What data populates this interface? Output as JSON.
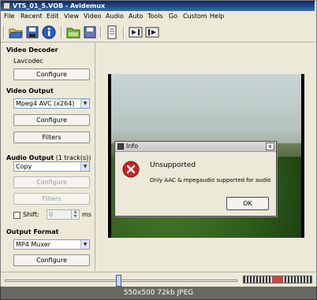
{
  "window": {
    "title": "VTS_01_5.VOB - Avidemux"
  },
  "menu": [
    "File",
    "Recent",
    "Edit",
    "View",
    "Video",
    "Audio",
    "Auto",
    "Tools",
    "Go",
    "Custom",
    "Help"
  ],
  "toolbar": {
    "icons": [
      "open-folder-icon",
      "save-icon",
      "info-icon",
      "open-green-icon",
      "save-small-icon",
      "document-icon",
      "play-to-icon",
      "play-from-icon"
    ]
  },
  "panel": {
    "video_decoder": {
      "heading": "Video Decoder",
      "codec": "Lavcodec",
      "configure": "Configure"
    },
    "video_output": {
      "heading": "Video Output",
      "selected": "Mpeg4 AVC (x264)",
      "configure": "Configure",
      "filters": "Filters"
    },
    "audio_output": {
      "heading": "Audio Output",
      "tracks": "(1 track(s))",
      "selected": "Copy",
      "configure": "Configure",
      "filters": "Filters",
      "shift_label": "Shift:",
      "shift_value": "0",
      "shift_unit": "ms"
    },
    "output_format": {
      "heading": "Output Format",
      "selected": "MP4 Muxer",
      "configure": "Configure"
    }
  },
  "dialog": {
    "title": "Info",
    "close": "x",
    "heading": "Unsupported",
    "message": "Only AAC & mpegaudio supported for audio",
    "ok": "OK"
  },
  "footer": {
    "caption": "550x500  72kb  JPEG"
  },
  "colors": {
    "title_bar": "#0a246a",
    "error_red": "#cc2222",
    "face": "#ece9d8"
  }
}
